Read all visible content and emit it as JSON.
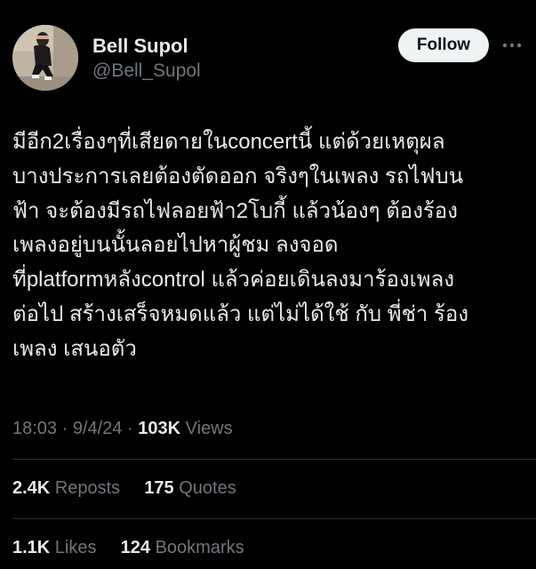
{
  "author": {
    "display_name": "Bell Supol",
    "handle": "@Bell_Supol",
    "avatar_icon": "profile-photo"
  },
  "header": {
    "follow_label": "Follow",
    "more_icon": "more-horizontal-icon"
  },
  "tweet": {
    "lines": [
      "มีอีก2เรื่องๆที่เสียดายในconcertนี้ แต่ด้วยเหตุผล",
      "บางประการเลยต้องตัดออก จริงๆในเพลง รถไฟบน",
      "ฟ้า จะต้องมีรถไฟลอยฟ้า2โบกี้ แล้วน้องๆ ต้องร้อง",
      "เพลงอยู่บนนั้นลอยไปหาผู้ชม ลงจอด",
      "ที่platformหลังcontrol แล้วค่อยเดินลงมาร้องเพลง",
      "ต่อไป สร้างเสร็จหมดแล้ว แต่ไม่ได้ใช้ กับ พี่ช่า ร้อง",
      "เพลง เสนอตัว"
    ]
  },
  "meta": {
    "time": "18:03",
    "separator": "·",
    "date": "9/4/24",
    "views_count": "103K",
    "views_label": "Views"
  },
  "stats": {
    "reposts_count": "2.4K",
    "reposts_label": "Reposts",
    "quotes_count": "175",
    "quotes_label": "Quotes",
    "likes_count": "1.1K",
    "likes_label": "Likes",
    "bookmarks_count": "124",
    "bookmarks_label": "Bookmarks"
  },
  "colors": {
    "background": "#000000",
    "primary_text": "#e7e9ea",
    "secondary_text": "#71767b",
    "divider": "#2f3336",
    "follow_button_bg": "#eff3f4",
    "follow_button_text": "#0f1419"
  }
}
